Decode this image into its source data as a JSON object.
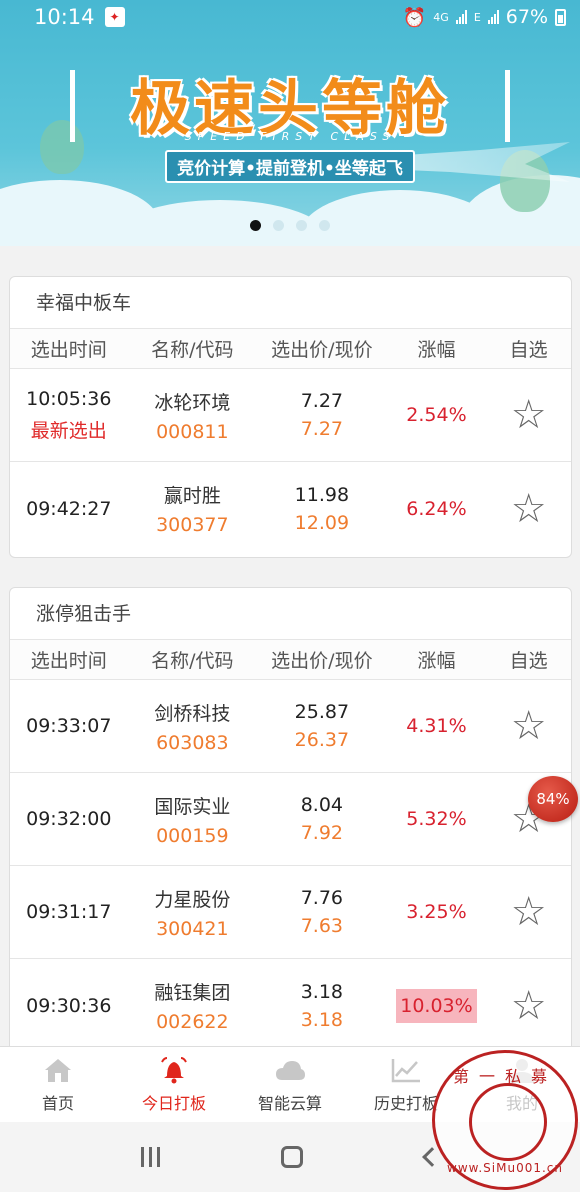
{
  "status_bar": {
    "time": "10:14",
    "network": "4G",
    "network2": "E",
    "battery": "67%"
  },
  "banner": {
    "title": "极速头等舱",
    "subtitle": "SPEED FIRST CLASS",
    "tagline": "竞价计算•提前登机•坐等起飞",
    "dots": 4,
    "active_dot": 0
  },
  "table_headers": {
    "time": "选出时间",
    "name": "名称/代码",
    "price": "选出价/现价",
    "change": "涨幅",
    "fav": "自选"
  },
  "sections": [
    {
      "title": "幸福中板车",
      "rows": [
        {
          "time": "10:05:36",
          "tag": "最新选出",
          "name": "冰轮环境",
          "code": "000811",
          "pick_price": "7.27",
          "cur_price": "7.27",
          "change": "2.54%",
          "highlight": false
        },
        {
          "time": "09:42:27",
          "tag": "",
          "name": "赢时胜",
          "code": "300377",
          "pick_price": "11.98",
          "cur_price": "12.09",
          "change": "6.24%",
          "highlight": false
        }
      ]
    },
    {
      "title": "涨停狙击手",
      "rows": [
        {
          "time": "09:33:07",
          "tag": "",
          "name": "剑桥科技",
          "code": "603083",
          "pick_price": "25.87",
          "cur_price": "26.37",
          "change": "4.31%",
          "highlight": false
        },
        {
          "time": "09:32:00",
          "tag": "",
          "name": "国际实业",
          "code": "000159",
          "pick_price": "8.04",
          "cur_price": "7.92",
          "change": "5.32%",
          "highlight": false
        },
        {
          "time": "09:31:17",
          "tag": "",
          "name": "力星股份",
          "code": "300421",
          "pick_price": "7.76",
          "cur_price": "7.63",
          "change": "3.25%",
          "highlight": false
        },
        {
          "time": "09:30:36",
          "tag": "",
          "name": "融钰集团",
          "code": "002622",
          "pick_price": "3.18",
          "cur_price": "3.18",
          "change": "10.03%",
          "highlight": true
        }
      ]
    }
  ],
  "floating_badge": "84%",
  "tabs": [
    {
      "label": "首页",
      "icon": "home-icon",
      "active": false
    },
    {
      "label": "今日打板",
      "icon": "bell-icon",
      "active": true
    },
    {
      "label": "智能云算",
      "icon": "cloud-icon",
      "active": false
    },
    {
      "label": "历史打板",
      "icon": "chart-icon",
      "active": false
    },
    {
      "label": "我的",
      "icon": "user-icon",
      "active": false
    }
  ],
  "watermark": {
    "top": "第一私募",
    "bottom": "www.SiMu001.cn"
  },
  "colors": {
    "accent": "#e0261c",
    "code_orange": "#ef7c2f",
    "banner_sky": "#48b8d2"
  }
}
